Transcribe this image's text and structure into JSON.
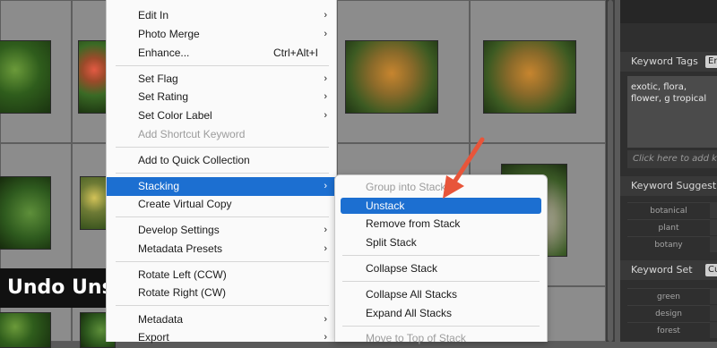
{
  "overlay_title": "Undo Unsta",
  "menu": {
    "items": [
      {
        "label": "Edit In",
        "shortcut": "",
        "submenu": true,
        "disabled": false
      },
      {
        "label": "Photo Merge",
        "shortcut": "",
        "submenu": true,
        "disabled": false
      },
      {
        "label": "Enhance...",
        "shortcut": "Ctrl+Alt+I",
        "submenu": false,
        "disabled": false
      },
      {
        "label": "Set Flag",
        "shortcut": "",
        "submenu": true,
        "disabled": false
      },
      {
        "label": "Set Rating",
        "shortcut": "",
        "submenu": true,
        "disabled": false
      },
      {
        "label": "Set Color Label",
        "shortcut": "",
        "submenu": true,
        "disabled": false
      },
      {
        "label": "Add Shortcut Keyword",
        "shortcut": "",
        "submenu": false,
        "disabled": true
      },
      {
        "label": "Add to Quick Collection",
        "shortcut": "",
        "submenu": false,
        "disabled": false
      },
      {
        "label": "Stacking",
        "shortcut": "",
        "submenu": true,
        "disabled": false,
        "highlighted": true
      },
      {
        "label": "Create Virtual Copy",
        "shortcut": "",
        "submenu": false,
        "disabled": false
      },
      {
        "label": "Develop Settings",
        "shortcut": "",
        "submenu": true,
        "disabled": false
      },
      {
        "label": "Metadata Presets",
        "shortcut": "",
        "submenu": true,
        "disabled": false
      },
      {
        "label": "Rotate Left (CCW)",
        "shortcut": "",
        "submenu": false,
        "disabled": false
      },
      {
        "label": "Rotate Right (CW)",
        "shortcut": "",
        "submenu": false,
        "disabled": false
      },
      {
        "label": "Metadata",
        "shortcut": "",
        "submenu": true,
        "disabled": false
      },
      {
        "label": "Export",
        "shortcut": "",
        "submenu": true,
        "disabled": false
      }
    ],
    "arrow_glyph": "›"
  },
  "submenu": {
    "items": [
      {
        "label": "Group into Stack",
        "disabled": true
      },
      {
        "label": "Unstack",
        "disabled": false,
        "highlighted": true
      },
      {
        "label": "Remove from Stack",
        "disabled": false
      },
      {
        "label": "Split Stack",
        "disabled": false
      },
      {
        "label": "Collapse Stack",
        "disabled": false
      },
      {
        "label": "Collapse All Stacks",
        "disabled": false
      },
      {
        "label": "Expand All Stacks",
        "disabled": false
      },
      {
        "label": "Move to Top of Stack",
        "disabled": true
      }
    ]
  },
  "panel": {
    "keyword_tags_label": "Keyword Tags",
    "keyword_tags_mode": "Er",
    "tags_text": "exotic, flora, flower, g tropical",
    "tags_hint": "Click here to add key",
    "suggestions_label": "Keyword Suggestion",
    "suggestions": [
      "botanical",
      "plant",
      "botany"
    ],
    "keyword_set_label": "Keyword Set",
    "keyword_set_value": "Cu",
    "set_items": [
      "green",
      "design",
      "forest"
    ]
  },
  "colors": {
    "highlight": "#1c6fd1",
    "annotation_arrow": "#e8553a"
  }
}
